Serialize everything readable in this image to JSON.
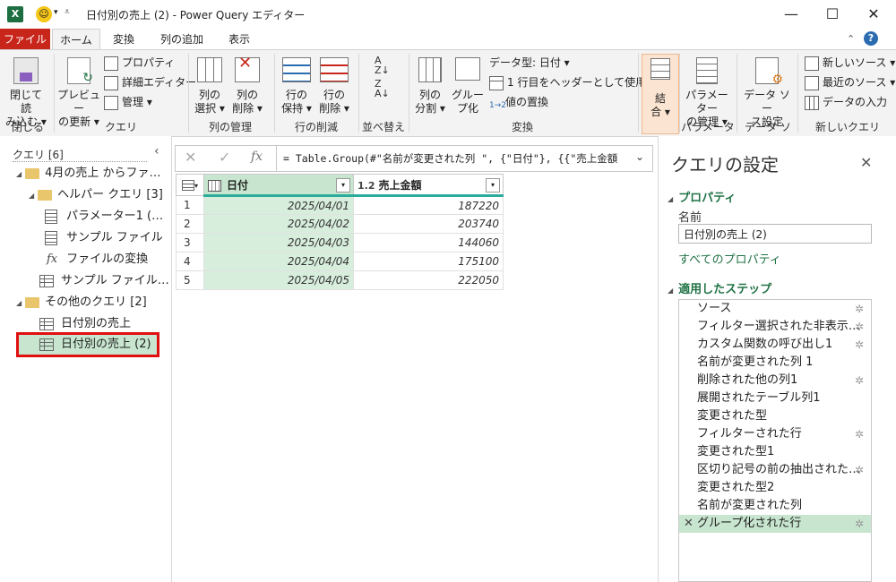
{
  "titlebar": {
    "app_icon": "excel-icon",
    "title": "日付別の売上 (2) - Power Query エディター",
    "min_label": "—",
    "max_label": "☐",
    "close_label": "✕"
  },
  "tabs": [
    {
      "label": "ファイル"
    },
    {
      "label": "ホーム"
    },
    {
      "label": "変換"
    },
    {
      "label": "列の追加"
    },
    {
      "label": "表示"
    }
  ],
  "ribbon": {
    "groups": {
      "close": "閉じる",
      "query": "クエリ",
      "manage_columns": "列の管理",
      "reduce_rows": "行の削減",
      "sort": "並べ替え",
      "transform": "変換",
      "combine": "",
      "parameters": "パラメーター",
      "datasource": "データ ソース",
      "newquery": "新しいクエリ"
    },
    "close_load": [
      "閉じて読",
      "み込む ▾"
    ],
    "preview": [
      "プレビュー",
      "の更新 ▾"
    ],
    "properties": "プロパティ",
    "advanced_editor": "詳細エディター",
    "manage": "管理 ▾",
    "choose_cols": [
      "列の",
      "選択 ▾"
    ],
    "remove_cols": [
      "列の",
      "削除 ▾"
    ],
    "keep_rows": [
      "行の",
      "保持 ▾"
    ],
    "remove_rows": [
      "行の",
      "削除 ▾"
    ],
    "split_col": [
      "列の",
      "分割 ▾"
    ],
    "group_by": [
      "グルー",
      "プ化"
    ],
    "data_type": "データ型: 日付 ▾",
    "first_row_header": "1 行目をヘッダーとして使用 ▾",
    "replace_values": "値の置換",
    "combine": [
      "結",
      "合 ▾"
    ],
    "manage_params": [
      "パラメーター",
      "の管理 ▾"
    ],
    "ds_settings": [
      "データ ソー",
      "ス設定"
    ],
    "new_source": "新しいソース ▾",
    "recent_sources": "最近のソース ▾",
    "enter_data": "データの入力"
  },
  "queries": {
    "header": "クエリ [6]",
    "items": [
      {
        "label": "4月の売上 からファ…"
      },
      {
        "label": "ヘルパー クエリ [3]"
      },
      {
        "label": "パラメーター1 (…"
      },
      {
        "label": "サンプル ファイル"
      },
      {
        "label": "ファイルの変換"
      },
      {
        "label": "サンプル ファイル…"
      },
      {
        "label": "その他のクエリ [2]"
      },
      {
        "label": "日付別の売上"
      },
      {
        "label": "日付別の売上 (2)"
      }
    ]
  },
  "formula": {
    "cancel": "✕",
    "confirm": "✓",
    "fx": "fx",
    "text": "= Table.Group(#\"名前が変更された列 \", {\"日付\"}, {{\"売上金額"
  },
  "grid": {
    "columns": [
      {
        "type": "",
        "name": "日付"
      },
      {
        "type": "1.2",
        "name": "売上金額"
      }
    ],
    "rows": [
      {
        "n": "1",
        "date": "2025/04/01",
        "value": "187220"
      },
      {
        "n": "2",
        "date": "2025/04/02",
        "value": "203740"
      },
      {
        "n": "3",
        "date": "2025/04/03",
        "value": "144060"
      },
      {
        "n": "4",
        "date": "2025/04/04",
        "value": "175100"
      },
      {
        "n": "5",
        "date": "2025/04/05",
        "value": "222050"
      }
    ]
  },
  "settings": {
    "title": "クエリの設定",
    "close": "✕",
    "properties_heading": "プロパティ",
    "name_label": "名前",
    "name_value": "日付別の売上 (2)",
    "all_properties": "すべてのプロパティ",
    "steps_heading": "適用したステップ",
    "steps": [
      {
        "label": "ソース",
        "gear": true
      },
      {
        "label": "フィルター選択された非表示…",
        "gear": true
      },
      {
        "label": "カスタム関数の呼び出し1",
        "gear": true
      },
      {
        "label": "名前が変更された列 1",
        "gear": false
      },
      {
        "label": "削除された他の列1",
        "gear": true
      },
      {
        "label": "展開されたテーブル列1",
        "gear": false
      },
      {
        "label": "変更された型",
        "gear": false
      },
      {
        "label": "フィルターされた行",
        "gear": true
      },
      {
        "label": "変更された型1",
        "gear": false
      },
      {
        "label": "区切り記号の前の抽出された…",
        "gear": true
      },
      {
        "label": "変更された型2",
        "gear": false
      },
      {
        "label": "名前が変更された列",
        "gear": false
      },
      {
        "label": "グループ化された行",
        "gear": true
      }
    ]
  },
  "colors": {
    "accent_green": "#217346",
    "file_tab": "#c8261b",
    "selection_red": "#e01010",
    "selected_fill": "#c8e6cf"
  }
}
